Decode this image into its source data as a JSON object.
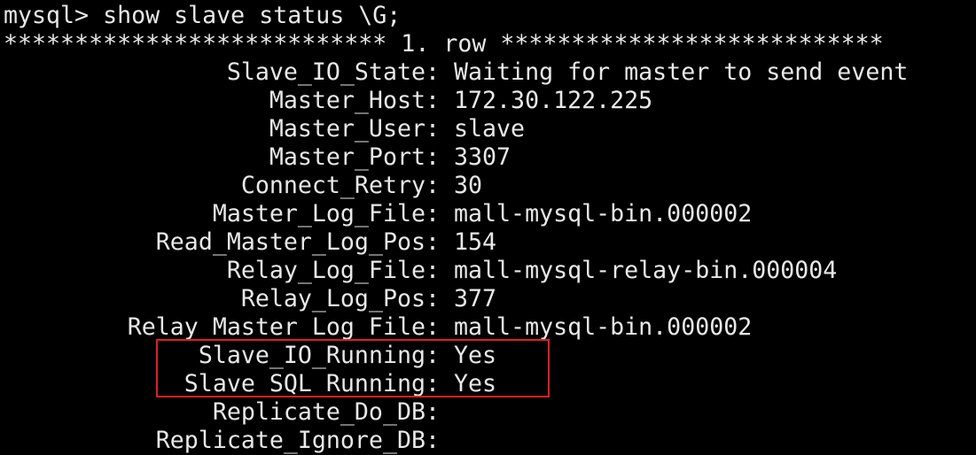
{
  "terminal": {
    "prompt": "mysql> show slave status \\G;",
    "row_header": "*************************** 1. row ***************************",
    "fields": [
      {
        "key": "Slave_IO_State:",
        "value": "Waiting for master to send event"
      },
      {
        "key": "Master_Host:",
        "value": "172.30.122.225"
      },
      {
        "key": "Master_User:",
        "value": "slave"
      },
      {
        "key": "Master_Port:",
        "value": "3307"
      },
      {
        "key": "Connect_Retry:",
        "value": "30"
      },
      {
        "key": "Master_Log_File:",
        "value": "mall-mysql-bin.000002"
      },
      {
        "key": "Read_Master_Log_Pos:",
        "value": "154"
      },
      {
        "key": "Relay_Log_File:",
        "value": "mall-mysql-relay-bin.000004"
      },
      {
        "key": "Relay_Log_Pos:",
        "value": "377"
      },
      {
        "key": "Relay_Master_Log_File:",
        "value": "mall-mysql-bin.000002"
      },
      {
        "key": "Slave_IO_Running:",
        "value": "Yes"
      },
      {
        "key": "Slave_SQL_Running:",
        "value": "Yes"
      },
      {
        "key": "Replicate_Do_DB:",
        "value": ""
      },
      {
        "key": "Replicate_Ignore_DB:",
        "value": ""
      }
    ],
    "highlight_color": "#e02020",
    "text_color": "#e8e8e8",
    "background_color": "#000000"
  }
}
